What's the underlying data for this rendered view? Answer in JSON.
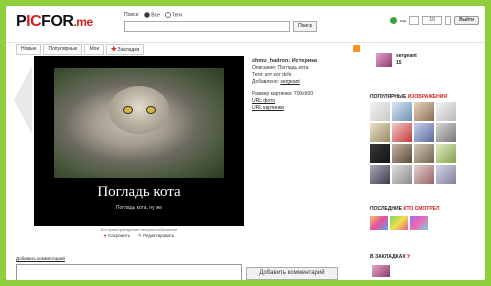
{
  "logo": {
    "pre": "P",
    "red": "IC",
    "post": "FOR",
    "suffix": ".me"
  },
  "search": {
    "label": "Поиск:",
    "option_all": "Все",
    "option_tags": "Теги",
    "button": "Поиск"
  },
  "login": {
    "mini_label": "sup",
    "value": "10",
    "exit_label": "Выйти"
  },
  "tabs": [
    "Новые",
    "Популярные",
    "Мои",
    "Закладки"
  ],
  "photo": {
    "caption": "Погладь кота",
    "subcaption": "Погладь кота, ну же",
    "note": "Все права принадлежат авторам изображений",
    "action_save": "Сохранить",
    "action_edit": "Редактировать"
  },
  "meta": {
    "title": "shmu_hadron: Истерика",
    "desc": "Описание: Погладь кота",
    "tags": "Теги: кот кот dchi",
    "added_by_label": "Добавлено:",
    "added_by": "sergeant",
    "size": "Размер картинки: 700x600",
    "url_photo": "URL фото",
    "url_page": "URL картинки"
  },
  "sidebar": {
    "username": "sergeant",
    "count": "15",
    "popular_a": "ПОПУЛЯРНЫЕ",
    "popular_b": "ИЗОБРАЖЕНИЯ",
    "latest_a": "ПОСЛЕДНИЕ",
    "latest_b": "КТО СМОТРЕЛ",
    "bookmarks_a": "В ЗАКЛАДКАХ",
    "bookmarks_b": "У"
  },
  "comments": {
    "add_link": "Добавить комментарий",
    "button": "Добавить комментарий"
  },
  "colors": {
    "accent": "#d42020",
    "background": "#8fcf3c"
  }
}
